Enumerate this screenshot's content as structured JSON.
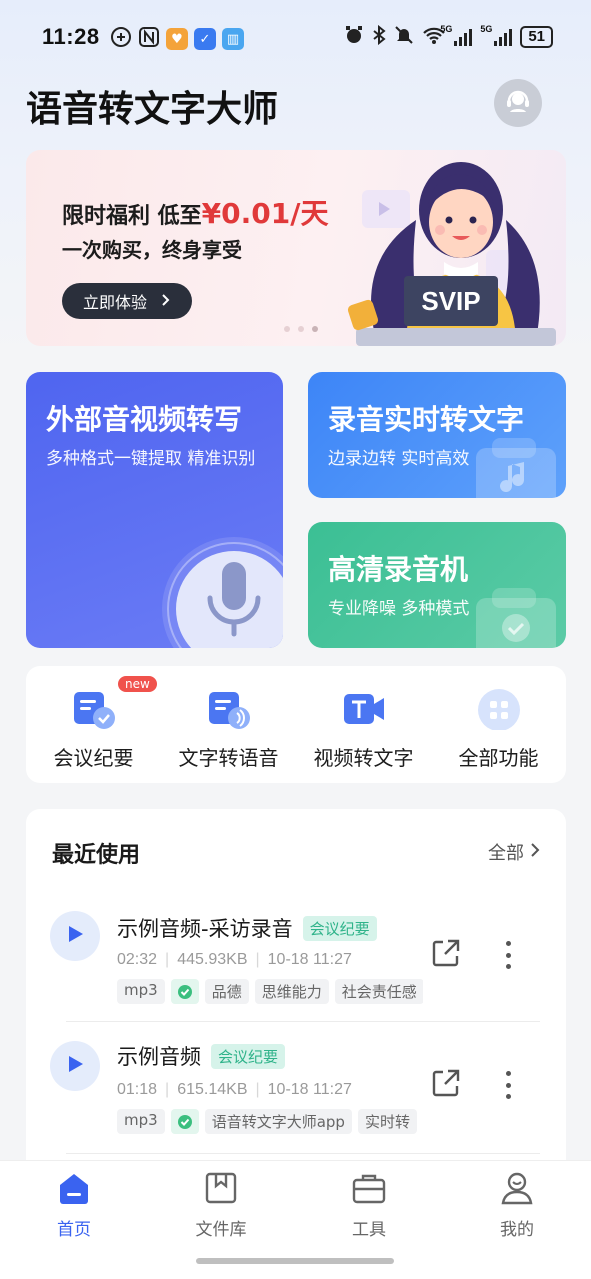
{
  "status_bar": {
    "time": "11:28",
    "battery": "51",
    "signal_label_1": "5G",
    "signal_label_2": "5G"
  },
  "header": {
    "title": "语音转文字大师"
  },
  "banner": {
    "line1_prefix": "限时福利 低至",
    "line1_price": "¥0.01/天",
    "line2": "一次购买，终身享受",
    "button": "立即体验",
    "illustration_text": "SVIP",
    "page_count": 3,
    "active_page": 3
  },
  "features": {
    "external": {
      "title": "外部音视频转写",
      "subtitle": "多种格式一键提取 精准识别"
    },
    "realtime": {
      "title": "录音实时转文字",
      "subtitle": "边录边转 实时高效"
    },
    "recorder": {
      "title": "高清录音机",
      "subtitle": "专业降噪 多种模式"
    }
  },
  "quick_tools": [
    {
      "label": "会议纪要",
      "badge": "new",
      "icon": "meeting-doc-icon"
    },
    {
      "label": "文字转语音",
      "icon": "text-to-speech-icon"
    },
    {
      "label": "视频转文字",
      "icon": "video-to-text-icon"
    },
    {
      "label": "全部功能",
      "icon": "grid-apps-icon"
    }
  ],
  "recent": {
    "title": "最近使用",
    "all_label": "全部",
    "items": [
      {
        "name": "示例音频-采访录音",
        "category": "会议纪要",
        "duration": "02:32",
        "size": "445.93KB",
        "date": "10-18 11:27",
        "format": "mp3",
        "tags": [
          "品德",
          "思维能力",
          "社会责任感"
        ]
      },
      {
        "name": "示例音频",
        "category": "会议纪要",
        "duration": "01:18",
        "size": "615.14KB",
        "date": "10-18 11:27",
        "format": "mp3",
        "tags": [
          "语音转文字大师app",
          "实时转"
        ]
      }
    ]
  },
  "bottom_nav": [
    {
      "label": "首页",
      "active": true
    },
    {
      "label": "文件库"
    },
    {
      "label": "工具"
    },
    {
      "label": "我的"
    }
  ],
  "colors": {
    "accent": "#3a63f0",
    "price_red": "#e0393a",
    "card_purple": "#5a6ef3",
    "card_blue": "#3d85f7",
    "card_green": "#3bbf94",
    "meeting_tag": "#2fb38a"
  }
}
